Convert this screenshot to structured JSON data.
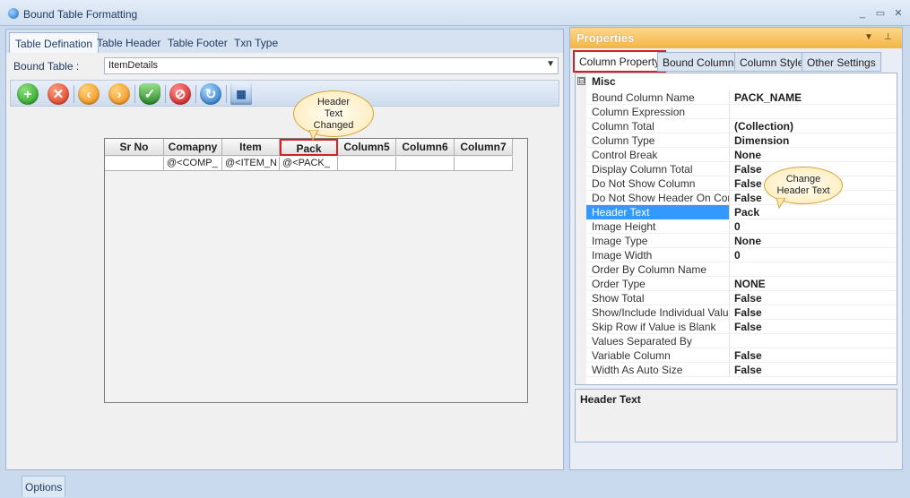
{
  "window": {
    "title": "Bound Table Formatting",
    "controls": [
      "_",
      "▭",
      "✕"
    ]
  },
  "left": {
    "tabs": [
      "Table Defination",
      "Table Header",
      "Table Footer",
      "Txn Type"
    ],
    "bound_table_label": "Bound Table :",
    "bound_table_value": "ItemDetails",
    "toolbar_icons": [
      "add-icon",
      "delete-icon",
      "back-icon",
      "forward-icon",
      "shield-check-icon",
      "stop-icon",
      "refresh-icon",
      "grid-layout-icon"
    ],
    "grid": {
      "headers": [
        "Sr No",
        "Comapny",
        "Item",
        "Pack",
        "Column5",
        "Column6",
        "Column7"
      ],
      "row": [
        "",
        "@<COMP_",
        "@<ITEM_N",
        "@<PACK_",
        "",
        "",
        ""
      ]
    },
    "callout": "Header Text Changed"
  },
  "properties": {
    "title": "Properties",
    "tabs": [
      "Column Property",
      "Bound Columns",
      "Column Style",
      "Other Settings"
    ],
    "category": "Misc",
    "category_toggle": "⊟",
    "rows": [
      {
        "name": "Bound Column Name",
        "value": "PACK_NAME"
      },
      {
        "name": "Column Expression",
        "value": ""
      },
      {
        "name": "Column Total",
        "value": "(Collection)"
      },
      {
        "name": "Column Type",
        "value": "Dimension"
      },
      {
        "name": "Control Break",
        "value": "None"
      },
      {
        "name": "Display Column Total",
        "value": "False"
      },
      {
        "name": "Do Not Show Column",
        "value": "False"
      },
      {
        "name": "Do Not Show Header On Contro",
        "value": "False"
      },
      {
        "name": "Header Text",
        "value": "Pack"
      },
      {
        "name": "Image Height",
        "value": "0"
      },
      {
        "name": "Image Type",
        "value": "None"
      },
      {
        "name": "Image Width",
        "value": "0"
      },
      {
        "name": "Order By Column Name",
        "value": ""
      },
      {
        "name": "Order Type",
        "value": "NONE"
      },
      {
        "name": "Show Total",
        "value": "False"
      },
      {
        "name": "Show/Include Individual Values",
        "value": "False"
      },
      {
        "name": "Skip Row if Value is Blank",
        "value": "False"
      },
      {
        "name": "Values Separated By",
        "value": ""
      },
      {
        "name": "Variable Column",
        "value": "False"
      },
      {
        "name": "Width As Auto Size",
        "value": "False"
      }
    ],
    "selected_row": "Header Text",
    "callout": "Change Header Text",
    "description_title": "Header Text"
  },
  "bottom": {
    "options_label": "Options"
  },
  "colors": {
    "accent_orange": "#f6b447",
    "highlight_red": "#d02222",
    "selection_blue": "#3399ff"
  }
}
